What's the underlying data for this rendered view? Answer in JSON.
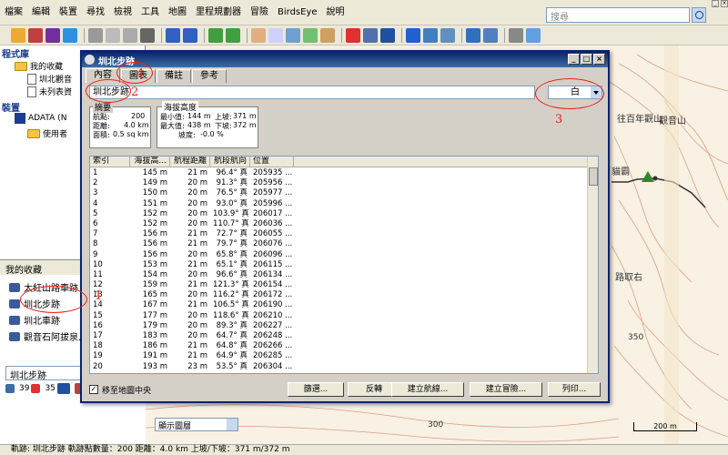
{
  "menubar": {
    "items": [
      "檔案",
      "編輯",
      "裝置",
      "尋找",
      "檢視",
      "工具",
      "地圖",
      "里程規劃器",
      "冒險",
      "BirdsEye",
      "說明"
    ],
    "search_placeholder": "搜尋"
  },
  "left_panel": {
    "library_header": "程式庫",
    "tree": [
      {
        "label": "我的收藏"
      },
      {
        "label": "圳北觀音"
      },
      {
        "label": "未列表資"
      }
    ],
    "device_header": "裝置",
    "device": "ADATA (N",
    "device_child": "使用者",
    "favorites_title": "我的收藏",
    "favorites": [
      "太紅山路車跡",
      "圳北步跡",
      "圳北車跡",
      "觀音石阿拔泉..."
    ],
    "bottom_select": "圳北步跡",
    "bottom_icons": [
      "39",
      "35"
    ]
  },
  "dialog": {
    "title": "圳北步跡",
    "tabs": [
      "內容",
      "圖表",
      "備註",
      "參考"
    ],
    "name_value": "圳北步跡",
    "color_value": "白",
    "summary": {
      "title": "摘要",
      "points_label": "航點:",
      "points_value": "200",
      "distance_label": "距離:",
      "distance_value": "4.0 km",
      "area_label": "面積:",
      "area_value": "0.5 sq km"
    },
    "elevation": {
      "title": "海拔高度",
      "min_label": "最小值:",
      "min_value": "144 m",
      "max_label": "最大值:",
      "max_value": "438 m",
      "up_label": "上坡:",
      "up_value": "371 m",
      "down_label": "下坡:",
      "down_value": "372 m",
      "slope_label": "坡度:",
      "slope_value": "-0.0 %"
    },
    "table": {
      "headers": [
        "索引",
        "海拔高...",
        "航程距離",
        "航段航向",
        "位置"
      ],
      "rows": [
        [
          "1",
          "145 m",
          "21 m",
          "96.4° 真",
          "205935 ..."
        ],
        [
          "2",
          "149 m",
          "20 m",
          "91.3° 真",
          "205956 ..."
        ],
        [
          "3",
          "150 m",
          "20 m",
          "76.5° 真",
          "205977 ..."
        ],
        [
          "4",
          "151 m",
          "20 m",
          "93.0° 真",
          "205996 ..."
        ],
        [
          "5",
          "152 m",
          "20 m",
          "103.9° 真",
          "206017 ..."
        ],
        [
          "6",
          "152 m",
          "20 m",
          "110.7° 真",
          "206036 ..."
        ],
        [
          "7",
          "156 m",
          "21 m",
          "72.7° 真",
          "206055 ..."
        ],
        [
          "8",
          "156 m",
          "21 m",
          "79.7° 真",
          "206076 ..."
        ],
        [
          "9",
          "156 m",
          "20 m",
          "65.8° 真",
          "206096 ..."
        ],
        [
          "10",
          "153 m",
          "21 m",
          "65.1° 真",
          "206115 ..."
        ],
        [
          "11",
          "154 m",
          "20 m",
          "96.6° 真",
          "206134 ..."
        ],
        [
          "12",
          "159 m",
          "21 m",
          "121.3° 真",
          "206154 ..."
        ],
        [
          "13",
          "165 m",
          "20 m",
          "116.2° 真",
          "206172 ..."
        ],
        [
          "14",
          "167 m",
          "21 m",
          "106.5° 真",
          "206190 ..."
        ],
        [
          "15",
          "177 m",
          "20 m",
          "118.6° 真",
          "206210 ..."
        ],
        [
          "16",
          "179 m",
          "20 m",
          "89.3° 真",
          "206227 ..."
        ],
        [
          "17",
          "183 m",
          "20 m",
          "64.7° 真",
          "206248 ..."
        ],
        [
          "18",
          "186 m",
          "21 m",
          "64.8° 真",
          "206266 ..."
        ],
        [
          "19",
          "191 m",
          "21 m",
          "64.9° 真",
          "206285 ..."
        ],
        [
          "20",
          "193 m",
          "23 m",
          "53.5° 真",
          "206304 ..."
        ]
      ]
    },
    "center_label": "移至地圖中央",
    "buttons": [
      "篩選...",
      "反轉",
      "建立航線...",
      "建立冒險...",
      "列印..."
    ]
  },
  "map": {
    "labels": [
      "往百年觀山",
      "觀音山",
      "貓霸",
      "路取右",
      "350",
      "300",
      "200 m"
    ],
    "display_select": "顯示圖層"
  },
  "annotations": [
    "1",
    "2",
    "3",
    "4"
  ],
  "status": "軌跡: 圳北步跡  軌跡點數量：200  距離：4.0 km  上坡/下坡：371 m/372 m"
}
